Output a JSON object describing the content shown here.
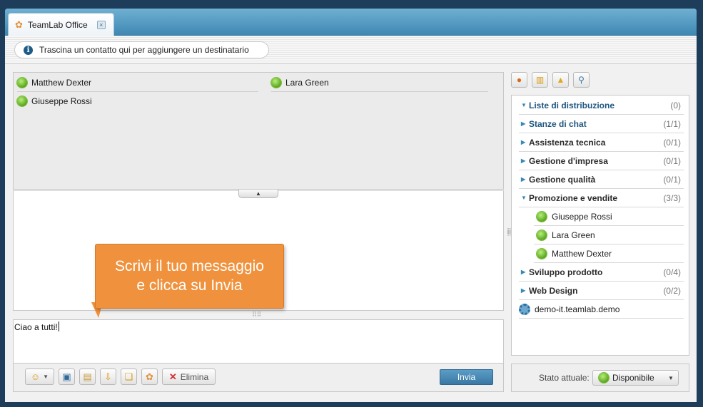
{
  "tab": {
    "title": "TeamLab Office",
    "close_symbol": "×"
  },
  "info": {
    "text": "Trascina un contatto qui per aggiungere un destinatario"
  },
  "recipients": [
    {
      "name": "Matthew Dexter"
    },
    {
      "name": "Lara Green"
    },
    {
      "name": "Giuseppe Rossi"
    }
  ],
  "callout": {
    "line1": "Scrivi il tuo messaggio",
    "line2": "e clicca su Invia"
  },
  "compose": {
    "value": "Ciao a tutti!"
  },
  "toolbar": {
    "delete_label": "Elimina",
    "send_label": "Invia"
  },
  "groups": [
    {
      "name": "Liste di distribuzione",
      "count": "(0)",
      "expanded": true
    },
    {
      "name": "Stanze di chat",
      "count": "(1/1)",
      "expanded": false
    },
    {
      "name": "Assistenza tecnica",
      "count": "(0/1)",
      "expanded": false
    },
    {
      "name": "Gestione d'impresa",
      "count": "(0/1)",
      "expanded": false
    },
    {
      "name": "Gestione qualità",
      "count": "(0/1)",
      "expanded": false
    },
    {
      "name": "Promozione e vendite",
      "count": "(3/3)",
      "expanded": true
    },
    {
      "name": "Sviluppo prodotto",
      "count": "(0/4)",
      "expanded": false
    },
    {
      "name": "Web Design",
      "count": "(0/2)",
      "expanded": false
    }
  ],
  "members": [
    {
      "name": "Giuseppe Rossi"
    },
    {
      "name": "Lara Green"
    },
    {
      "name": "Matthew Dexter"
    }
  ],
  "server": {
    "name": "demo-it.teamlab.demo"
  },
  "status": {
    "label": "Stato attuale:",
    "value": "Disponibile"
  },
  "colors": {
    "accent": "#3f88b3",
    "callout": "#f0923d",
    "online": "#5aa51f"
  }
}
